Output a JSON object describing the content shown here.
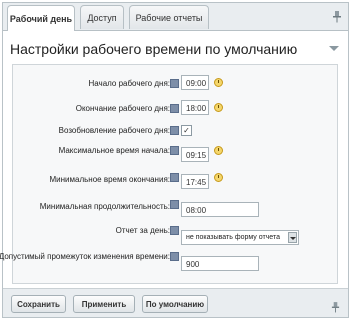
{
  "tabs": [
    {
      "label": "Рабочий день",
      "active": true
    },
    {
      "label": "Доступ",
      "active": false
    },
    {
      "label": "Рабочие отчеты",
      "active": false
    }
  ],
  "panel": {
    "title": "Настройки рабочего времени по умолчанию"
  },
  "fields": {
    "day_start": {
      "label": "Начало рабочего дня:",
      "value": "09:00"
    },
    "day_end": {
      "label": "Окончание рабочего дня:",
      "value": "18:00"
    },
    "resume": {
      "label": "Возобновление рабочего дня:",
      "checked": true,
      "check_glyph": "✓"
    },
    "max_start": {
      "label": "Максимальное время начала:",
      "value": "09:15"
    },
    "min_end": {
      "label": "Минимальное время окончания:",
      "value": "17:45"
    },
    "min_duration": {
      "label": "Минимальная продолжительность:",
      "value": "08:00"
    },
    "day_report": {
      "label": "Отчет за день:",
      "selected": "не показывать форму отчета"
    },
    "allowed_change": {
      "label": "Допустимый промежуток изменения времени:",
      "value": "900"
    }
  },
  "buttons": {
    "save": "Сохранить",
    "apply": "Применить",
    "default": "По умолчанию"
  },
  "icons": {
    "pin": "pin-icon",
    "clock": "clock-icon",
    "lock_checkbox": "override-checkbox"
  },
  "colors": {
    "accent_checkbox": "#7d8ea8",
    "clock": "#f4d66b"
  }
}
